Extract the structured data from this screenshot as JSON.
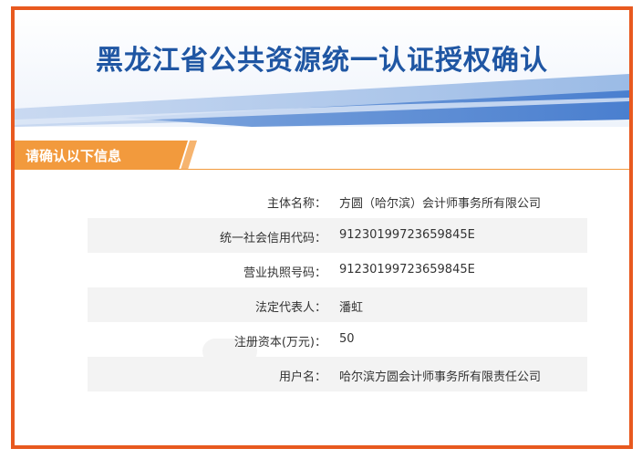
{
  "header": {
    "title": "黑龙江省公共资源统一认证授权确认"
  },
  "section": {
    "title": "请确认以下信息"
  },
  "fields": [
    {
      "label": "主体名称：",
      "value": "方圆（哈尔滨）会计师事务所有限公司"
    },
    {
      "label": "统一社会信用代码：",
      "value": "91230199723659845E"
    },
    {
      "label": "营业执照号码：",
      "value": "91230199723659845E"
    },
    {
      "label": "法定代表人：",
      "value": "潘虹"
    },
    {
      "label": "注册资本(万元)：",
      "value": "50"
    },
    {
      "label": "用户名：",
      "value": "哈尔滨方圆会计师事务所有限责任公司"
    }
  ],
  "colors": {
    "frame": "#e8591f",
    "title": "#1f56a3",
    "accent_orange": "#f29a3d",
    "banner_blue": "#5b8fd6"
  }
}
